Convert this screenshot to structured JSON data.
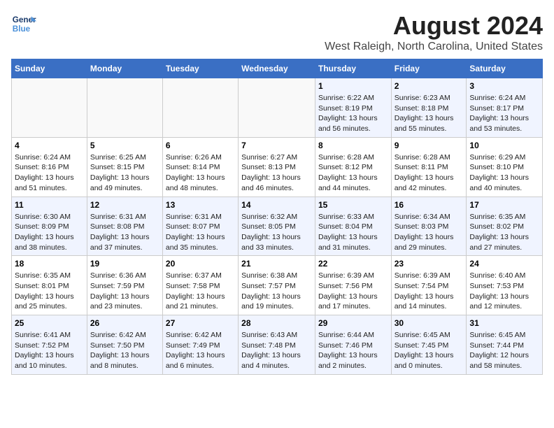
{
  "header": {
    "logo_line1": "General",
    "logo_line2": "Blue",
    "title": "August 2024",
    "subtitle": "West Raleigh, North Carolina, United States"
  },
  "days_of_week": [
    "Sunday",
    "Monday",
    "Tuesday",
    "Wednesday",
    "Thursday",
    "Friday",
    "Saturday"
  ],
  "weeks": [
    [
      {
        "day": "",
        "info": ""
      },
      {
        "day": "",
        "info": ""
      },
      {
        "day": "",
        "info": ""
      },
      {
        "day": "",
        "info": ""
      },
      {
        "day": "1",
        "info": "Sunrise: 6:22 AM\nSunset: 8:19 PM\nDaylight: 13 hours\nand 56 minutes."
      },
      {
        "day": "2",
        "info": "Sunrise: 6:23 AM\nSunset: 8:18 PM\nDaylight: 13 hours\nand 55 minutes."
      },
      {
        "day": "3",
        "info": "Sunrise: 6:24 AM\nSunset: 8:17 PM\nDaylight: 13 hours\nand 53 minutes."
      }
    ],
    [
      {
        "day": "4",
        "info": "Sunrise: 6:24 AM\nSunset: 8:16 PM\nDaylight: 13 hours\nand 51 minutes."
      },
      {
        "day": "5",
        "info": "Sunrise: 6:25 AM\nSunset: 8:15 PM\nDaylight: 13 hours\nand 49 minutes."
      },
      {
        "day": "6",
        "info": "Sunrise: 6:26 AM\nSunset: 8:14 PM\nDaylight: 13 hours\nand 48 minutes."
      },
      {
        "day": "7",
        "info": "Sunrise: 6:27 AM\nSunset: 8:13 PM\nDaylight: 13 hours\nand 46 minutes."
      },
      {
        "day": "8",
        "info": "Sunrise: 6:28 AM\nSunset: 8:12 PM\nDaylight: 13 hours\nand 44 minutes."
      },
      {
        "day": "9",
        "info": "Sunrise: 6:28 AM\nSunset: 8:11 PM\nDaylight: 13 hours\nand 42 minutes."
      },
      {
        "day": "10",
        "info": "Sunrise: 6:29 AM\nSunset: 8:10 PM\nDaylight: 13 hours\nand 40 minutes."
      }
    ],
    [
      {
        "day": "11",
        "info": "Sunrise: 6:30 AM\nSunset: 8:09 PM\nDaylight: 13 hours\nand 38 minutes."
      },
      {
        "day": "12",
        "info": "Sunrise: 6:31 AM\nSunset: 8:08 PM\nDaylight: 13 hours\nand 37 minutes."
      },
      {
        "day": "13",
        "info": "Sunrise: 6:31 AM\nSunset: 8:07 PM\nDaylight: 13 hours\nand 35 minutes."
      },
      {
        "day": "14",
        "info": "Sunrise: 6:32 AM\nSunset: 8:05 PM\nDaylight: 13 hours\nand 33 minutes."
      },
      {
        "day": "15",
        "info": "Sunrise: 6:33 AM\nSunset: 8:04 PM\nDaylight: 13 hours\nand 31 minutes."
      },
      {
        "day": "16",
        "info": "Sunrise: 6:34 AM\nSunset: 8:03 PM\nDaylight: 13 hours\nand 29 minutes."
      },
      {
        "day": "17",
        "info": "Sunrise: 6:35 AM\nSunset: 8:02 PM\nDaylight: 13 hours\nand 27 minutes."
      }
    ],
    [
      {
        "day": "18",
        "info": "Sunrise: 6:35 AM\nSunset: 8:01 PM\nDaylight: 13 hours\nand 25 minutes."
      },
      {
        "day": "19",
        "info": "Sunrise: 6:36 AM\nSunset: 7:59 PM\nDaylight: 13 hours\nand 23 minutes."
      },
      {
        "day": "20",
        "info": "Sunrise: 6:37 AM\nSunset: 7:58 PM\nDaylight: 13 hours\nand 21 minutes."
      },
      {
        "day": "21",
        "info": "Sunrise: 6:38 AM\nSunset: 7:57 PM\nDaylight: 13 hours\nand 19 minutes."
      },
      {
        "day": "22",
        "info": "Sunrise: 6:39 AM\nSunset: 7:56 PM\nDaylight: 13 hours\nand 17 minutes."
      },
      {
        "day": "23",
        "info": "Sunrise: 6:39 AM\nSunset: 7:54 PM\nDaylight: 13 hours\nand 14 minutes."
      },
      {
        "day": "24",
        "info": "Sunrise: 6:40 AM\nSunset: 7:53 PM\nDaylight: 13 hours\nand 12 minutes."
      }
    ],
    [
      {
        "day": "25",
        "info": "Sunrise: 6:41 AM\nSunset: 7:52 PM\nDaylight: 13 hours\nand 10 minutes."
      },
      {
        "day": "26",
        "info": "Sunrise: 6:42 AM\nSunset: 7:50 PM\nDaylight: 13 hours\nand 8 minutes."
      },
      {
        "day": "27",
        "info": "Sunrise: 6:42 AM\nSunset: 7:49 PM\nDaylight: 13 hours\nand 6 minutes."
      },
      {
        "day": "28",
        "info": "Sunrise: 6:43 AM\nSunset: 7:48 PM\nDaylight: 13 hours\nand 4 minutes."
      },
      {
        "day": "29",
        "info": "Sunrise: 6:44 AM\nSunset: 7:46 PM\nDaylight: 13 hours\nand 2 minutes."
      },
      {
        "day": "30",
        "info": "Sunrise: 6:45 AM\nSunset: 7:45 PM\nDaylight: 13 hours\nand 0 minutes."
      },
      {
        "day": "31",
        "info": "Sunrise: 6:45 AM\nSunset: 7:44 PM\nDaylight: 12 hours\nand 58 minutes."
      }
    ]
  ]
}
